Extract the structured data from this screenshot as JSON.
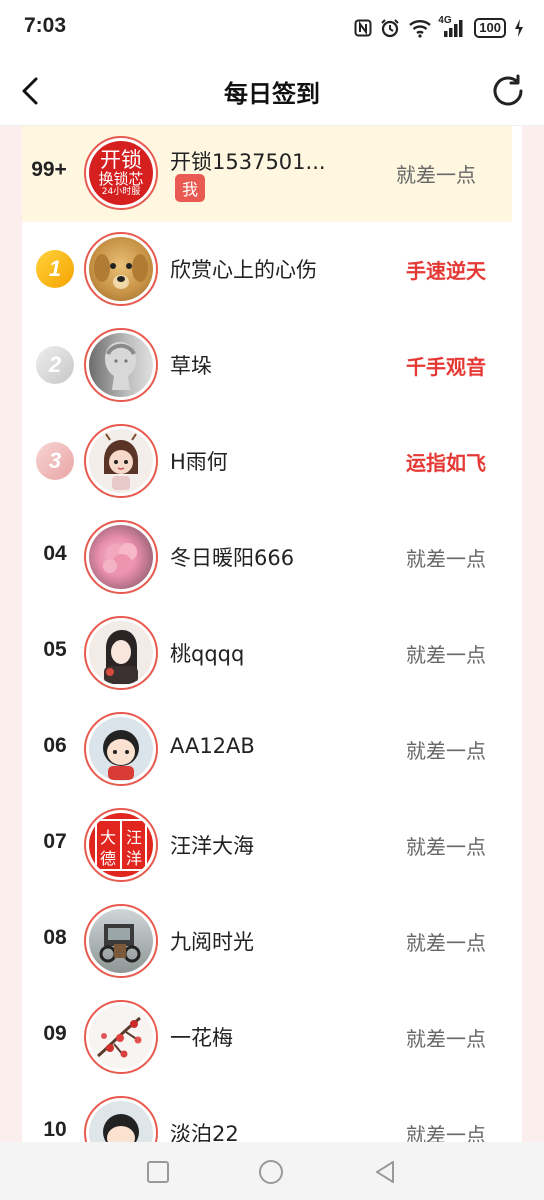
{
  "status_bar": {
    "time": "7:03",
    "battery": "100",
    "icons": [
      "nfc-icon",
      "alarm-icon",
      "wifi-icon",
      "signal-4g-icon",
      "battery-icon",
      "charging-icon"
    ],
    "network_label": "4G"
  },
  "header": {
    "title": "每日签到"
  },
  "me_row": {
    "rank": "99+",
    "name": "开锁1537501...",
    "badge": "我",
    "status": "就差一点",
    "avatar_text": {
      "top": "开锁",
      "mid": "换锁芯",
      "bottom": "24小时服"
    }
  },
  "rows": [
    {
      "rank": "1",
      "name": "欣赏心上的心伤",
      "status": "手速逆天"
    },
    {
      "rank": "2",
      "name": "草垛",
      "status": "千手观音"
    },
    {
      "rank": "3",
      "name": "H雨何",
      "status": "运指如飞"
    },
    {
      "rank": "04",
      "name": "冬日暖阳666",
      "status": "就差一点"
    },
    {
      "rank": "05",
      "name": "桃qqqq",
      "status": "就差一点"
    },
    {
      "rank": "06",
      "name": "AA12AB",
      "status": "就差一点"
    },
    {
      "rank": "07",
      "name": "汪洋大海",
      "status": "就差一点",
      "avatar_text": "大德 汪洋"
    },
    {
      "rank": "08",
      "name": "九阅时光",
      "status": "就差一点"
    },
    {
      "rank": "09",
      "name": "一花梅",
      "status": "就差一点"
    },
    {
      "rank": "10",
      "name": "淡泊22",
      "status": "就差一点"
    }
  ],
  "colors": {
    "accent_red": "#e53935",
    "me_row_bg": "#fff7e0",
    "side_pink": "#fdeeee",
    "avatar_ring": "#e85a50"
  }
}
